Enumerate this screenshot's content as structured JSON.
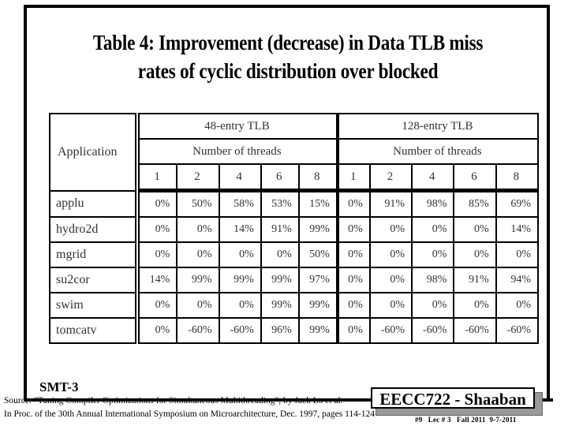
{
  "slide": {
    "title_line1": "Table 4: Improvement (decrease) in Data TLB miss",
    "title_line2": "rates of cyclic distribution over blocked",
    "label": "SMT-3"
  },
  "table": {
    "app_header": "Application",
    "groups": [
      {
        "label": "48-entry TLB",
        "sub": "Number of threads",
        "threads": [
          "1",
          "2",
          "4",
          "6",
          "8"
        ]
      },
      {
        "label": "128-entry TLB",
        "sub": "Number of threads",
        "threads": [
          "1",
          "2",
          "4",
          "6",
          "8"
        ]
      }
    ],
    "rows": [
      {
        "app": "applu",
        "tlb48": [
          "0%",
          "50%",
          "58%",
          "53%",
          "15%"
        ],
        "tlb128": [
          "0%",
          "91%",
          "98%",
          "85%",
          "69%"
        ]
      },
      {
        "app": "hydro2d",
        "tlb48": [
          "0%",
          "0%",
          "14%",
          "91%",
          "99%"
        ],
        "tlb128": [
          "0%",
          "0%",
          "0%",
          "0%",
          "14%"
        ]
      },
      {
        "app": "mgrid",
        "tlb48": [
          "0%",
          "0%",
          "0%",
          "0%",
          "50%"
        ],
        "tlb128": [
          "0%",
          "0%",
          "0%",
          "0%",
          "0%"
        ]
      },
      {
        "app": "su2cor",
        "tlb48": [
          "14%",
          "99%",
          "99%",
          "99%",
          "97%"
        ],
        "tlb128": [
          "0%",
          "0%",
          "98%",
          "91%",
          "94%"
        ]
      },
      {
        "app": "swim",
        "tlb48": [
          "0%",
          "0%",
          "0%",
          "99%",
          "99%"
        ],
        "tlb128": [
          "0%",
          "0%",
          "0%",
          "0%",
          "0%"
        ]
      },
      {
        "app": "tomcatv",
        "tlb48": [
          "0%",
          "-60%",
          "-60%",
          "96%",
          "99%"
        ],
        "tlb128": [
          "0%",
          "-60%",
          "-60%",
          "-60%",
          "-60%"
        ]
      }
    ]
  },
  "footer": {
    "source_line1": "Source: \"Tuning Compiler Optimizations for Simultaneous Multithreading\", by Jack Lo et al.",
    "source_line2": "In Proc. of the 30th Annual International Symposium on Microarchitecture, Dec. 1997, pages 114-124",
    "brand": "EECC722 - Shaaban",
    "lecture_info": "#9   Lec # 3   Fall 2011  9-7-2011"
  }
}
